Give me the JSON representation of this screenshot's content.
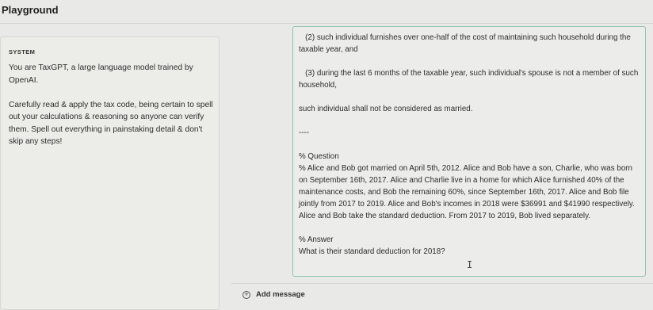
{
  "app": {
    "title": "Playground"
  },
  "system": {
    "label": "SYSTEM",
    "text": "You are TaxGPT, a large language model trained by OpenAI.\n\nCarefully read & apply the tax code, being certain to spell out your calculations & reasoning so anyone can verify them. Spell out everything in painstaking detail & don't skip any steps!"
  },
  "message": {
    "text": "   (2) such individual furnishes over one-half of the cost of maintaining such household during the taxable year, and\n\n   (3) during the last 6 months of the taxable year, such individual's spouse is not a member of such household,\n\nsuch individual shall not be considered as married.\n\n----\n\n% Question\n% Alice and Bob got married on April 5th, 2012. Alice and Bob have a son, Charlie, who was born on September 16th, 2017. Alice and Charlie live in a home for which Alice furnished 40% of the maintenance costs, and Bob the remaining 60%, since September 16th, 2017. Alice and Bob file jointly from 2017 to 2019. Alice and Bob's incomes in 2018 were $36991 and $41990 respectively. Alice and Bob take the standard deduction. From 2017 to 2019, Bob lived separately.\n\n% Answer\nWhat is their standard deduction for 2018?"
  },
  "add_message": {
    "icon": "plus-circle-icon",
    "label": "Add message"
  },
  "cursor": {
    "glyph": "I"
  },
  "colors": {
    "background": "#e9e9e7",
    "focus_border": "#8fc3ad"
  }
}
